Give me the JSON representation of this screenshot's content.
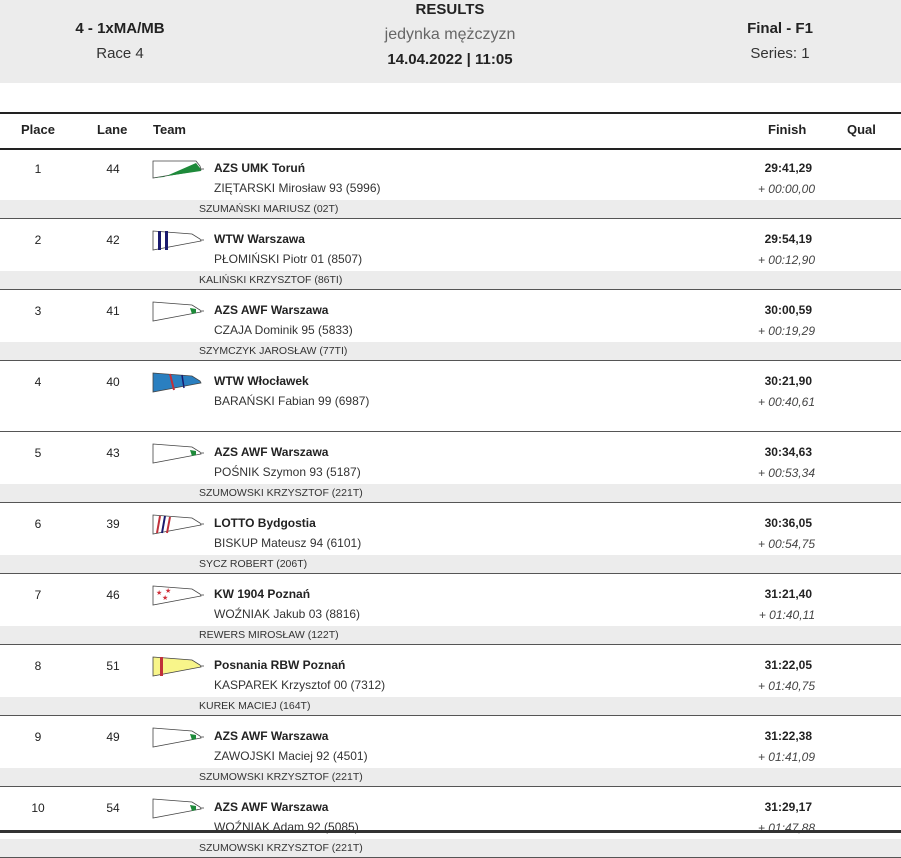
{
  "header": {
    "event": "4 - 1xMA/MB",
    "race": "Race 4",
    "title": "RESULTS",
    "subtitle": "jedynka mężczyzn",
    "datetime": "14.04.2022 | 11:05",
    "phase": "Final - F1",
    "series": "Series: 1"
  },
  "columns": {
    "place": "Place",
    "lane": "Lane",
    "team": "Team",
    "finish": "Finish",
    "qual": "Qual"
  },
  "rows": [
    {
      "place": "1",
      "lane": "44",
      "team": "AZS UMK Toruń",
      "rower": "ZIĘTARSKI  Mirosław 93 (5996)",
      "time": "29:41,29",
      "diff": "+ 00:00,00",
      "coach": "SZUMAŃSKI MARIUSZ (02T)",
      "oar": "umk"
    },
    {
      "place": "2",
      "lane": "42",
      "team": "WTW Warszawa",
      "rower": "PŁOMIŃSKI  Piotr 01 (8507)",
      "time": "29:54,19",
      "diff": "+ 00:12,90",
      "coach": "KALIŃSKI KRZYSZTOF (86TI)",
      "oar": "wtw"
    },
    {
      "place": "3",
      "lane": "41",
      "team": "AZS AWF Warszawa",
      "rower": "CZAJA  Dominik 95 (5833)",
      "time": "30:00,59",
      "diff": "+ 00:19,29",
      "coach": "SZYMCZYK JAROSŁAW (77TI)",
      "oar": "awf"
    },
    {
      "place": "4",
      "lane": "40",
      "team": "WTW Włocławek",
      "rower": "BARAŃSKI  Fabian 99 (6987)",
      "time": "30:21,90",
      "diff": "+ 00:40,61",
      "coach": "",
      "oar": "wloc"
    },
    {
      "place": "5",
      "lane": "43",
      "team": "AZS AWF Warszawa",
      "rower": "POŚNIK  Szymon 93 (5187)",
      "time": "30:34,63",
      "diff": "+ 00:53,34",
      "coach": "SZUMOWSKI KRZYSZTOF (221T)",
      "oar": "awf"
    },
    {
      "place": "6",
      "lane": "39",
      "team": "LOTTO Bydgostia",
      "rower": "BISKUP  Mateusz 94 (6101)",
      "time": "30:36,05",
      "diff": "+ 00:54,75",
      "coach": "SYCZ ROBERT (206T)",
      "oar": "lotto"
    },
    {
      "place": "7",
      "lane": "46",
      "team": "KW 1904 Poznań",
      "rower": "WOŹNIAK  Jakub 03 (8816)",
      "time": "31:21,40",
      "diff": "+ 01:40,11",
      "coach": "REWERS MIROSŁAW (122T)",
      "oar": "kw"
    },
    {
      "place": "8",
      "lane": "51",
      "team": "Posnania RBW Poznań",
      "rower": "KASPAREK  Krzysztof 00 (7312)",
      "time": "31:22,05",
      "diff": "+ 01:40,75",
      "coach": "KUREK MACIEJ (164T)",
      "oar": "posn"
    },
    {
      "place": "9",
      "lane": "49",
      "team": "AZS AWF Warszawa",
      "rower": "ZAWOJSKI  Maciej 92 (4501)",
      "time": "31:22,38",
      "diff": "+ 01:41,09",
      "coach": "SZUMOWSKI KRZYSZTOF (221T)",
      "oar": "awf"
    },
    {
      "place": "10",
      "lane": "54",
      "team": "AZS AWF Warszawa",
      "rower": "WOŹNIAK  Adam 92 (5085)",
      "time": "31:29,17",
      "diff": "+ 01:47,88",
      "coach": "SZUMOWSKI KRZYSZTOF (221T)",
      "oar": "awf"
    }
  ]
}
